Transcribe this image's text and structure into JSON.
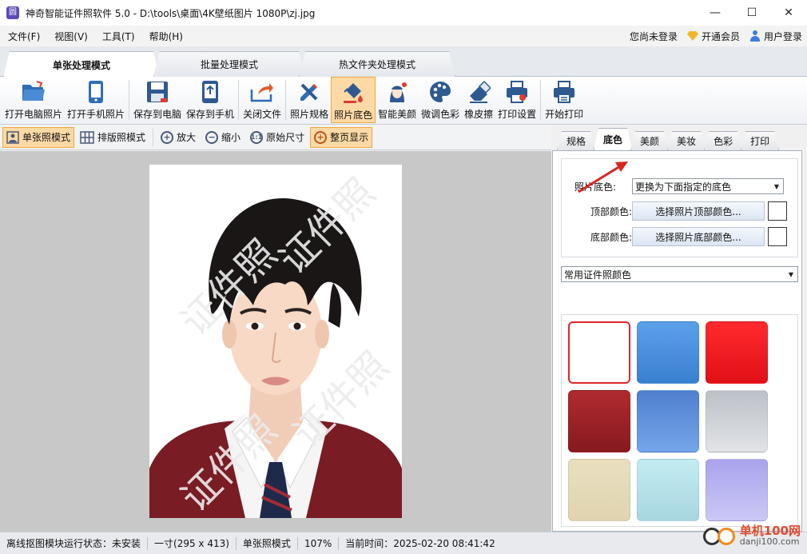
{
  "window": {
    "app_icon": "圆",
    "title": "神奇智能证件照软件 5.0 - D:\\tools\\桌面\\4K壁纸图片 1080P\\zj.jpg",
    "minimize": "—",
    "maximize": "☐",
    "close": "✕"
  },
  "menu": {
    "items": [
      "文件(F)",
      "视图(V)",
      "工具(T)",
      "帮助(H)"
    ],
    "login_status": "您尚未登录",
    "vip": "开通会员",
    "user_login": "用户登录"
  },
  "mode_tabs": [
    "单张处理模式",
    "批量处理模式",
    "热文件夹处理模式"
  ],
  "toolbar": {
    "open_pc": "打开电脑照片",
    "open_phone": "打开手机照片",
    "save_pc": "保存到电脑",
    "save_phone": "保存到手机",
    "close_file": "关闭文件",
    "photo_spec": "照片规格",
    "photo_bg": "照片底色",
    "beauty": "智能美颜",
    "color_adjust": "微调色彩",
    "eraser": "橡皮擦",
    "print_setup": "打印设置",
    "start_print": "开始打印"
  },
  "view_toolbar": {
    "single_mode": "单张照模式",
    "layout_mode": "排版照模式",
    "zoom_in": "放大",
    "zoom_out": "缩小",
    "original_size": "原始尺寸",
    "fit_page": "整页显示"
  },
  "right_tabs": [
    "规格",
    "底色",
    "美颜",
    "美妆",
    "色彩",
    "打印"
  ],
  "bg_settings": {
    "bg_label": "照片底色:",
    "bg_value": "更换为下面指定的底色",
    "top_label": "顶部颜色:",
    "top_button": "选择照片顶部颜色...",
    "bottom_label": "底部颜色:",
    "bottom_button": "选择照片底部颜色...",
    "preset_value": "常用证件照颜色"
  },
  "swatches": [
    {
      "color": "#ffffff",
      "selected": true
    },
    {
      "color": "#4a90dc"
    },
    {
      "color": "#f31a22"
    },
    {
      "color": "#9a1f25"
    },
    {
      "color": "#5b8ed8"
    },
    {
      "color": "#c8ccd2"
    },
    {
      "color": "#e6dcbc"
    },
    {
      "color": "#b8e2ea"
    },
    {
      "color": "#b7b4ef"
    }
  ],
  "status": {
    "module": "离线抠图模块运行状态：未安装",
    "size": "一寸(295 x 413)",
    "mode": "单张照模式",
    "zoom": "107%",
    "time": "当前时间：2025-02-20 08:41:42"
  },
  "watermark": {
    "text": "单机100网",
    "url": "danji100.com"
  }
}
